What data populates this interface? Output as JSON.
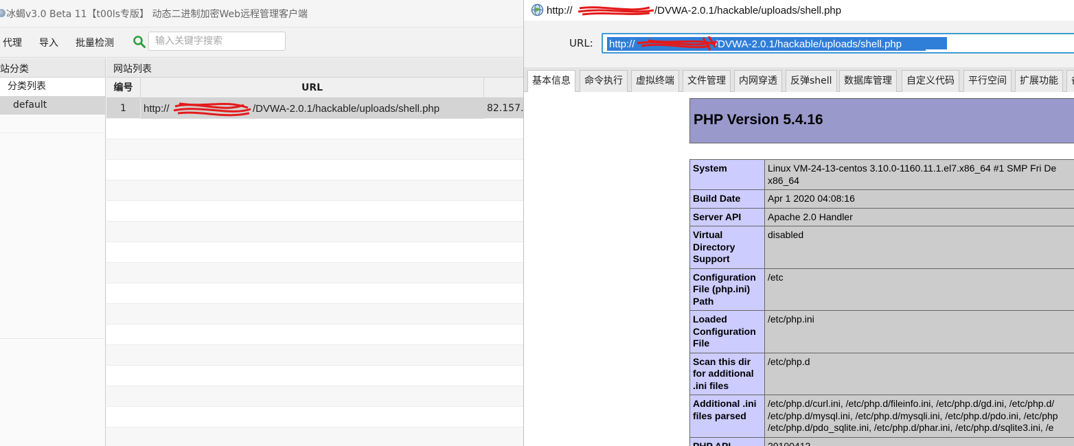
{
  "main_window": {
    "title": "冰蝎v3.0 Beta 11【t00ls专版】 动态二进制加密Web远程管理客户端",
    "toolbar": {
      "proxy_label": "代理",
      "import_label": "导入",
      "batch_check_label": "批量检测",
      "search_placeholder": "输入关键字搜索"
    },
    "category_panel": {
      "header": "网站分类",
      "root_label": "分类列表",
      "items": [
        "default"
      ]
    },
    "site_panel": {
      "header": "网站列表",
      "columns": [
        "编号",
        "URL"
      ],
      "rows": [
        {
          "num": "1",
          "url": "http://██.███.███.███/DVWA-2.0.1/hackable/uploads/shell.php",
          "ip": "82.157."
        }
      ]
    }
  },
  "shell_window": {
    "title": "http://██.███.███.███/DVWA-2.0.1/hackable/uploads/shell.php",
    "url_label": "URL:",
    "url_value": "http://██.███.███.███/DVWA-2.0.1/hackable/uploads/shell.php",
    "tabs": [
      "基本信息",
      "命令执行",
      "虚拟终端",
      "文件管理",
      "内网穿透",
      "反弹shell",
      "数据库管理",
      "自定义代码",
      "平行空间",
      "扩展功能",
      "备"
    ],
    "active_tab": 0,
    "phpinfo": {
      "version": "PHP Version 5.4.16",
      "rows": [
        {
          "key": "System",
          "value": "Linux VM-24-13-centos 3.10.0-1160.11.1.el7.x86_64 #1 SMP Fri De\nx86_64"
        },
        {
          "key": "Build Date",
          "value": "Apr 1 2020 04:08:16"
        },
        {
          "key": "Server API",
          "value": "Apache 2.0 Handler"
        },
        {
          "key": "Virtual Directory Support",
          "value": "disabled"
        },
        {
          "key": "Configuration File (php.ini) Path",
          "value": "/etc"
        },
        {
          "key": "Loaded Configuration File",
          "value": "/etc/php.ini"
        },
        {
          "key": "Scan this dir for additional .ini files",
          "value": "/etc/php.d"
        },
        {
          "key": "Additional .ini files parsed",
          "value": "/etc/php.d/curl.ini, /etc/php.d/fileinfo.ini, /etc/php.d/gd.ini, /etc/php.d/\n/etc/php.d/mysql.ini, /etc/php.d/mysqli.ini, /etc/php.d/pdo.ini, /etc/php\n/etc/php.d/pdo_sqlite.ini, /etc/php.d/phar.ini, /etc/php.d/sqlite3.ini, /e"
        },
        {
          "key": "PHP API",
          "value": "20100412"
        }
      ]
    }
  },
  "colors": {
    "selection_blue": "#2f7ed8",
    "url_focus_border": "#3c9ad8",
    "phpinfo_header": "#9999cc",
    "phpinfo_key": "#ccccff",
    "phpinfo_value": "#cccccc",
    "search_green": "#2e9e3e",
    "redaction_red": "#e41a1a"
  }
}
